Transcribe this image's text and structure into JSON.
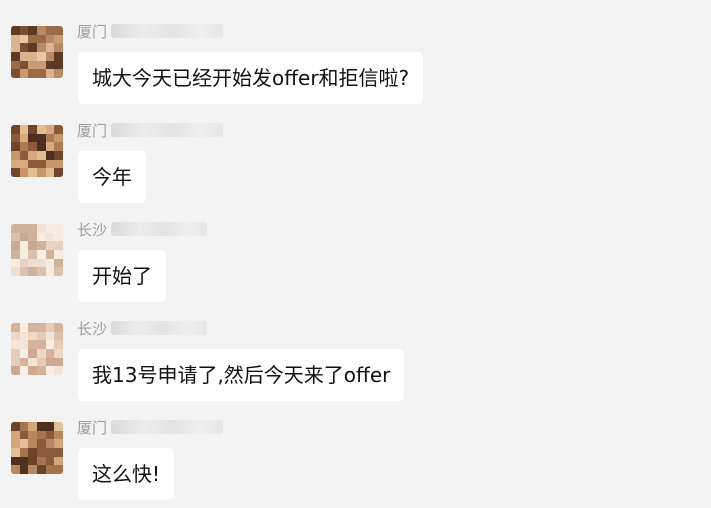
{
  "messages": [
    {
      "sender_city": "厦门",
      "text": "城大今天已经开始发offer和拒信啦?"
    },
    {
      "sender_city": "厦门",
      "text": "今年"
    },
    {
      "sender_city": "长沙",
      "text": "开始了"
    },
    {
      "sender_city": "长沙",
      "text": "我13号申请了,然后今天来了offer"
    },
    {
      "sender_city": "厦门",
      "text": "这么快!"
    }
  ],
  "colors": {
    "background": "#f3f3f3",
    "bubble": "#ffffff",
    "sender_text": "#9e9e9e",
    "message_text": "#111111"
  }
}
